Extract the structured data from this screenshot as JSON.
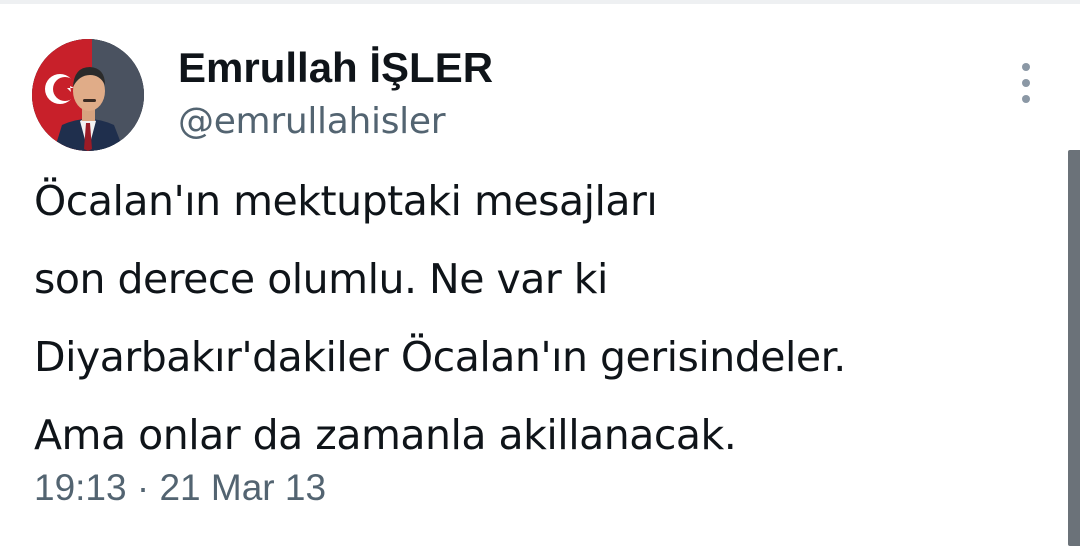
{
  "author": {
    "display_name": "Emrullah İŞLER",
    "handle": "@emrullahisler"
  },
  "tweet": {
    "text_lines": [
      "Öcalan'ın mektuptaki mesajları",
      "son derece olumlu. Ne var ki",
      "Diyarbakır'dakiler Öcalan'ın gerisindeler.",
      "Ama onlar da zamanla akillanacak."
    ],
    "timestamp": "19:13 · 21 Mar 13"
  },
  "icons": {
    "more": "more-vertical-icon"
  },
  "colors": {
    "text_primary": "#0f1419",
    "text_secondary": "#536471",
    "scrollbar": "#6b7279"
  }
}
